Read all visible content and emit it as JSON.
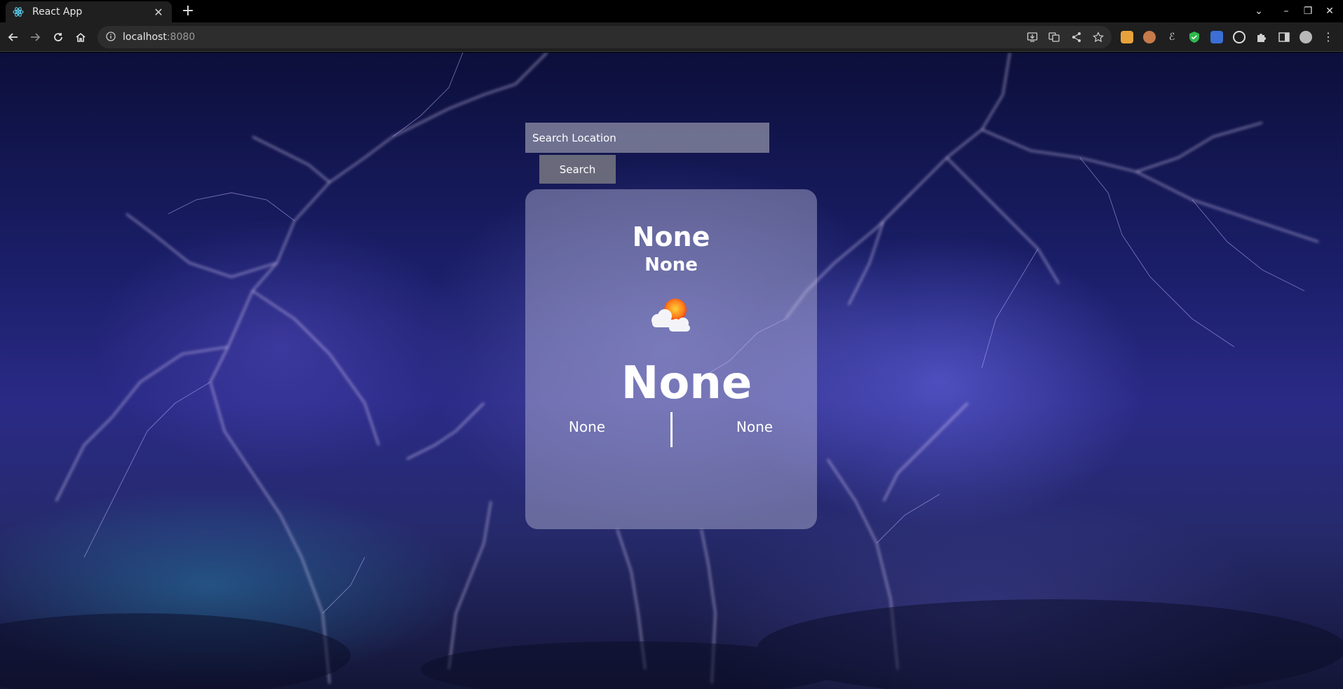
{
  "browser": {
    "tab_title": "React App",
    "url_host": "localhost",
    "url_port": ":8080"
  },
  "search": {
    "placeholder": "Search Location",
    "button_label": "Search"
  },
  "weather": {
    "location": "None",
    "country": "None",
    "icon": "sun-behind-cloud-icon",
    "temperature": "None",
    "left_stat": "None",
    "right_stat": "None"
  },
  "colors": {
    "browser_bg": "#000000",
    "toolbar_bg": "#1f1f1f",
    "card_bg": "#c3c3e1"
  }
}
